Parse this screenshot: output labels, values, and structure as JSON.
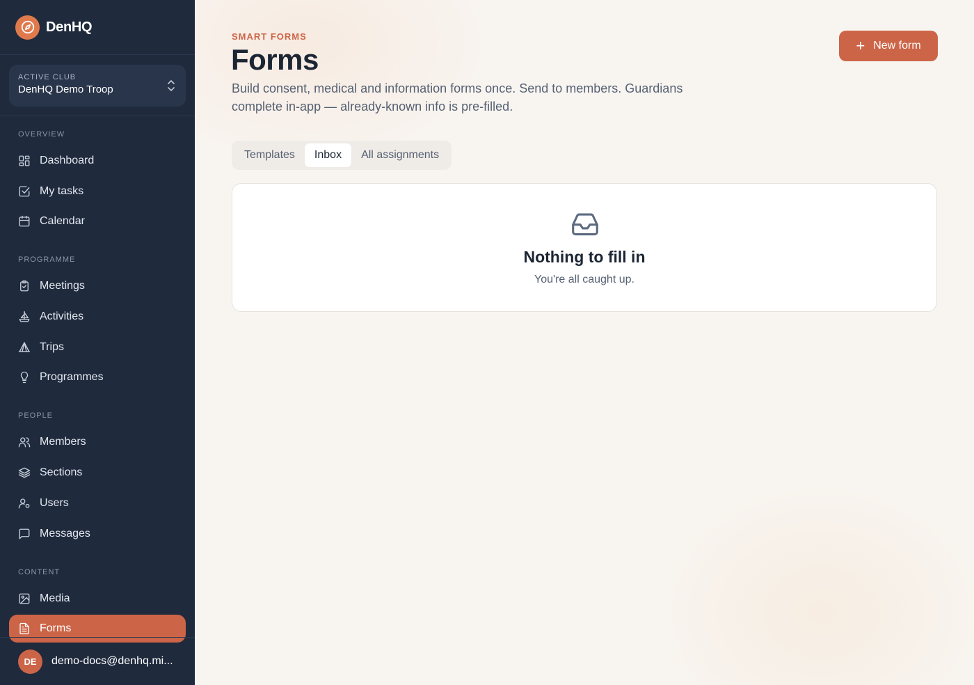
{
  "brand": {
    "name": "DenHQ",
    "logo_icon": "compass-icon",
    "accent": "#e07a4d"
  },
  "club": {
    "label": "ACTIVE CLUB",
    "name": "DenHQ Demo Troop"
  },
  "nav": {
    "overview": {
      "label": "OVERVIEW",
      "items": [
        {
          "label": "Dashboard",
          "icon": "dashboard-icon"
        },
        {
          "label": "My tasks",
          "icon": "check-square-icon"
        },
        {
          "label": "Calendar",
          "icon": "calendar-icon"
        }
      ]
    },
    "programme": {
      "label": "PROGRAMME",
      "items": [
        {
          "label": "Meetings",
          "icon": "clipboard-check-icon"
        },
        {
          "label": "Activities",
          "icon": "sailboat-icon"
        },
        {
          "label": "Trips",
          "icon": "tent-icon"
        },
        {
          "label": "Programmes",
          "icon": "lightbulb-icon"
        }
      ]
    },
    "people": {
      "label": "PEOPLE",
      "items": [
        {
          "label": "Members",
          "icon": "users-icon"
        },
        {
          "label": "Sections",
          "icon": "layers-icon"
        },
        {
          "label": "Users",
          "icon": "user-cog-icon"
        },
        {
          "label": "Messages",
          "icon": "message-square-icon"
        }
      ]
    },
    "content": {
      "label": "CONTENT",
      "items": [
        {
          "label": "Media",
          "icon": "image-icon"
        },
        {
          "label": "Forms",
          "icon": "file-text-icon",
          "active": true
        }
      ]
    }
  },
  "user": {
    "initials": "DE",
    "email": "demo-docs@denhq.mi..."
  },
  "header": {
    "eyebrow": "SMART FORMS",
    "title": "Forms",
    "description": "Build consent, medical and information forms once. Send to members. Guardians complete in-app — already-known info is pre-filled.",
    "new_button": "New form"
  },
  "tabs": [
    {
      "label": "Templates",
      "active": false
    },
    {
      "label": "Inbox",
      "active": true
    },
    {
      "label": "All assignments",
      "active": false
    }
  ],
  "empty_state": {
    "icon": "inbox-icon",
    "title": "Nothing to fill in",
    "subtitle": "You're all caught up."
  },
  "colors": {
    "sidebar_bg": "#1f2a3d",
    "accent": "#cc6548",
    "page_bg": "#f8f5f1"
  }
}
